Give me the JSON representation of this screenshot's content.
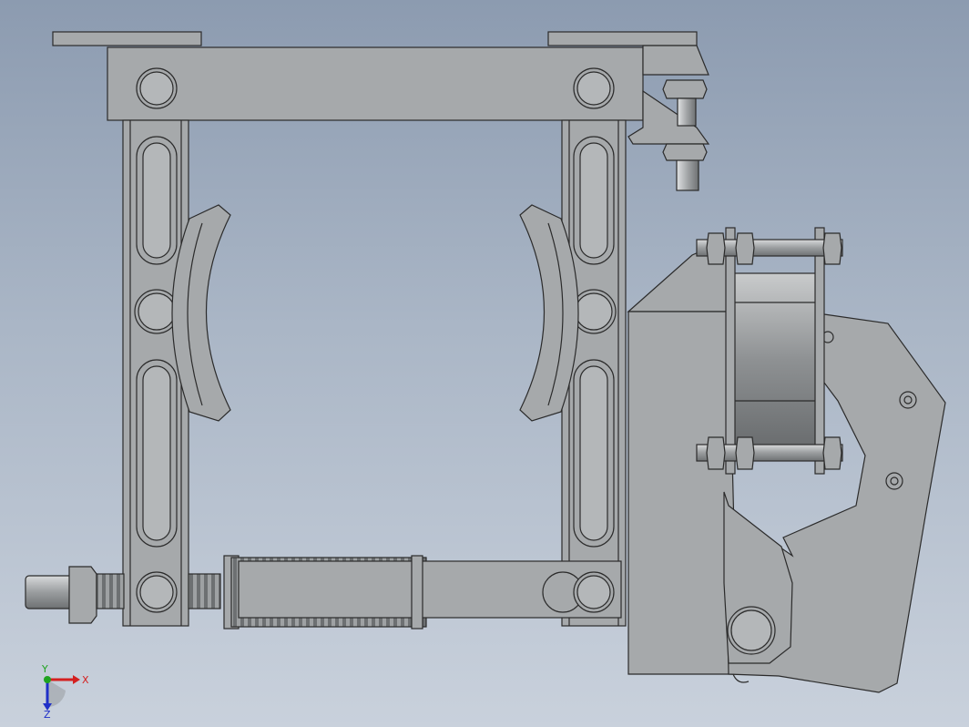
{
  "viewport": {
    "background_top": "#8c9bb0",
    "background_bottom": "#c9d1dc",
    "part_fill": "#a6a9ab",
    "part_stroke": "#2b2b2b"
  },
  "triad": {
    "x_label": "X",
    "y_label": "Y",
    "z_label": "Z",
    "x_color": "#d42020",
    "y_color": "#1fa31f",
    "z_color": "#2030c8"
  }
}
